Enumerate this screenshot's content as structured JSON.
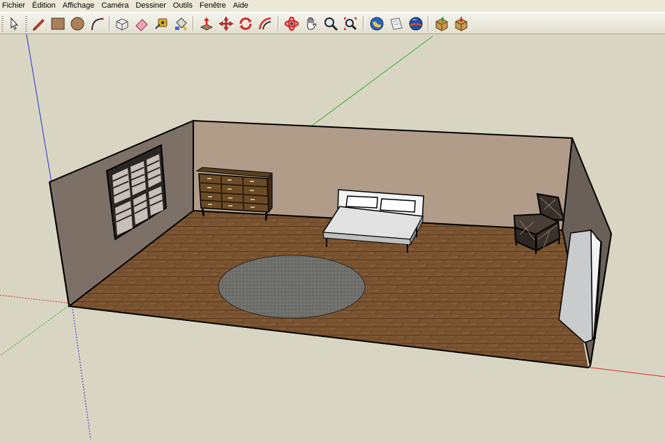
{
  "menu": {
    "items": [
      {
        "label": "Fichier"
      },
      {
        "label": "Édition"
      },
      {
        "label": "Affichage"
      },
      {
        "label": "Caméra"
      },
      {
        "label": "Dessiner"
      },
      {
        "label": "Outils"
      },
      {
        "label": "Fenêtre"
      },
      {
        "label": "Aide"
      }
    ]
  },
  "toolbar": {
    "tools": [
      {
        "name": "select-tool",
        "icon": "arrow-cursor-icon"
      },
      {
        "name": "line-tool",
        "icon": "pencil-icon"
      },
      {
        "name": "rectangle-tool",
        "icon": "rectangle-icon"
      },
      {
        "name": "circle-tool",
        "icon": "circle-icon"
      },
      {
        "name": "arc-tool",
        "icon": "arc-icon"
      },
      {
        "name": "make-component-tool",
        "icon": "component-icon"
      },
      {
        "name": "eraser-tool",
        "icon": "eraser-icon"
      },
      {
        "name": "tape-measure-tool",
        "icon": "tape-measure-icon"
      },
      {
        "name": "paint-bucket-tool",
        "icon": "paint-bucket-icon"
      },
      {
        "name": "push-pull-tool",
        "icon": "push-pull-icon"
      },
      {
        "name": "move-tool",
        "icon": "move-arrows-icon"
      },
      {
        "name": "rotate-tool",
        "icon": "rotate-icon"
      },
      {
        "name": "offset-tool",
        "icon": "offset-icon"
      },
      {
        "name": "orbit-tool",
        "icon": "orbit-icon"
      },
      {
        "name": "pan-tool",
        "icon": "hand-icon"
      },
      {
        "name": "zoom-tool",
        "icon": "magnifier-icon"
      },
      {
        "name": "zoom-extents-tool",
        "icon": "zoom-extents-icon"
      },
      {
        "name": "get-models-tool",
        "icon": "globe-icon"
      },
      {
        "name": "share-model-tool",
        "icon": "share-model-icon"
      },
      {
        "name": "google-earth-tool",
        "icon": "earth-icon"
      },
      {
        "name": "get-components-tool",
        "icon": "components-box-icon"
      },
      {
        "name": "share-component-tool",
        "icon": "share-component-icon"
      }
    ]
  },
  "colors": {
    "background": "#d8d6c2",
    "floor": "#7a5330",
    "back_wall": "#b09c89",
    "left_wall": "#7c7067",
    "right_wall": "#6a6058",
    "axis_red": "#d42a2a",
    "axis_green": "#2fae2f",
    "axis_blue": "#2a2ad4"
  }
}
